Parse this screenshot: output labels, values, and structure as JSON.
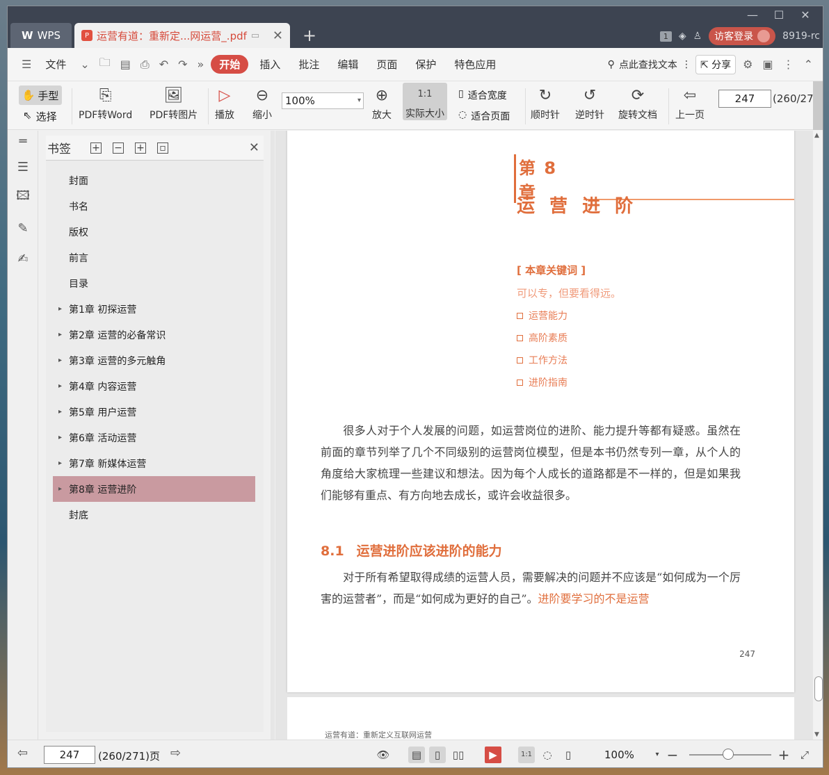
{
  "titlebar": {
    "wps_label": "WPS",
    "doc_tab_title": "运营有道：重新定...网运营_.pdf",
    "login_label": "访客登录",
    "user_label": "8919-rc",
    "badge": "1"
  },
  "menu": {
    "file": "文件",
    "start": "开始",
    "items": [
      "插入",
      "批注",
      "编辑",
      "页面",
      "保护",
      "特色应用"
    ],
    "search": "点此查找文本",
    "share": "分享"
  },
  "toolbar": {
    "hand": "手型",
    "select": "选择",
    "pdf_word": "PDF转Word",
    "pdf_image": "PDF转图片",
    "play": "播放",
    "zoom_out": "缩小",
    "zoom_value": "100%",
    "zoom_in": "放大",
    "actual_size": "实际大小",
    "fit_width": "适合宽度",
    "fit_page": "适合页面",
    "clockwise": "顺时针",
    "counter_clockwise": "逆时针",
    "rotate_doc": "旋转文档",
    "prev_page": "上一页",
    "page_input": "247",
    "page_total": "(260/27"
  },
  "bookmarks": {
    "title": "书签",
    "items": [
      {
        "label": "封面"
      },
      {
        "label": "书名"
      },
      {
        "label": "版权"
      },
      {
        "label": "前言"
      },
      {
        "label": "目录"
      },
      {
        "label": "第1章  初探运营"
      },
      {
        "label": "第2章  运营的必备常识"
      },
      {
        "label": "第3章  运营的多元触角"
      },
      {
        "label": "第4章  内容运营"
      },
      {
        "label": "第5章  用户运营"
      },
      {
        "label": "第6章  活动运营"
      },
      {
        "label": "第7章  新媒体运营"
      },
      {
        "label": "第8章  运营进阶"
      },
      {
        "label": "封底"
      }
    ]
  },
  "page": {
    "chapter": "第 8 章",
    "chapter_title": "运 营 进 阶",
    "keywords_head": "[ 本章关键词 ]",
    "keywords_sub": "可以专，但要看得远。",
    "keywords": [
      "运营能力",
      "高阶素质",
      "工作方法",
      "进阶指南"
    ],
    "para1": "很多人对于个人发展的问题，如运营岗位的进阶、能力提升等都有疑惑。虽然在前面的章节列举了几个不同级别的运营岗位模型，但是本书仍然专列一章，从个人的角度给大家梳理一些建议和想法。因为每个人成长的道路都是不一样的，但是如果我们能够有重点、有方向地去成长，或许会收益很多。",
    "section_num": "8.1",
    "section_title": "运营进阶应该进阶的能力",
    "para2": "对于所有希望取得成绩的运营人员，需要解决的问题并不应该是“如何成为一个厉害的运营者”，而是“如何成为更好的自己”。",
    "para2_highlight": "进阶要学习的不是运营",
    "page_number": "247",
    "next_running_head": "运营有道：重新定义互联网运营"
  },
  "status": {
    "page_input": "247",
    "page_total": "(260/271)页",
    "zoom": "100%"
  }
}
